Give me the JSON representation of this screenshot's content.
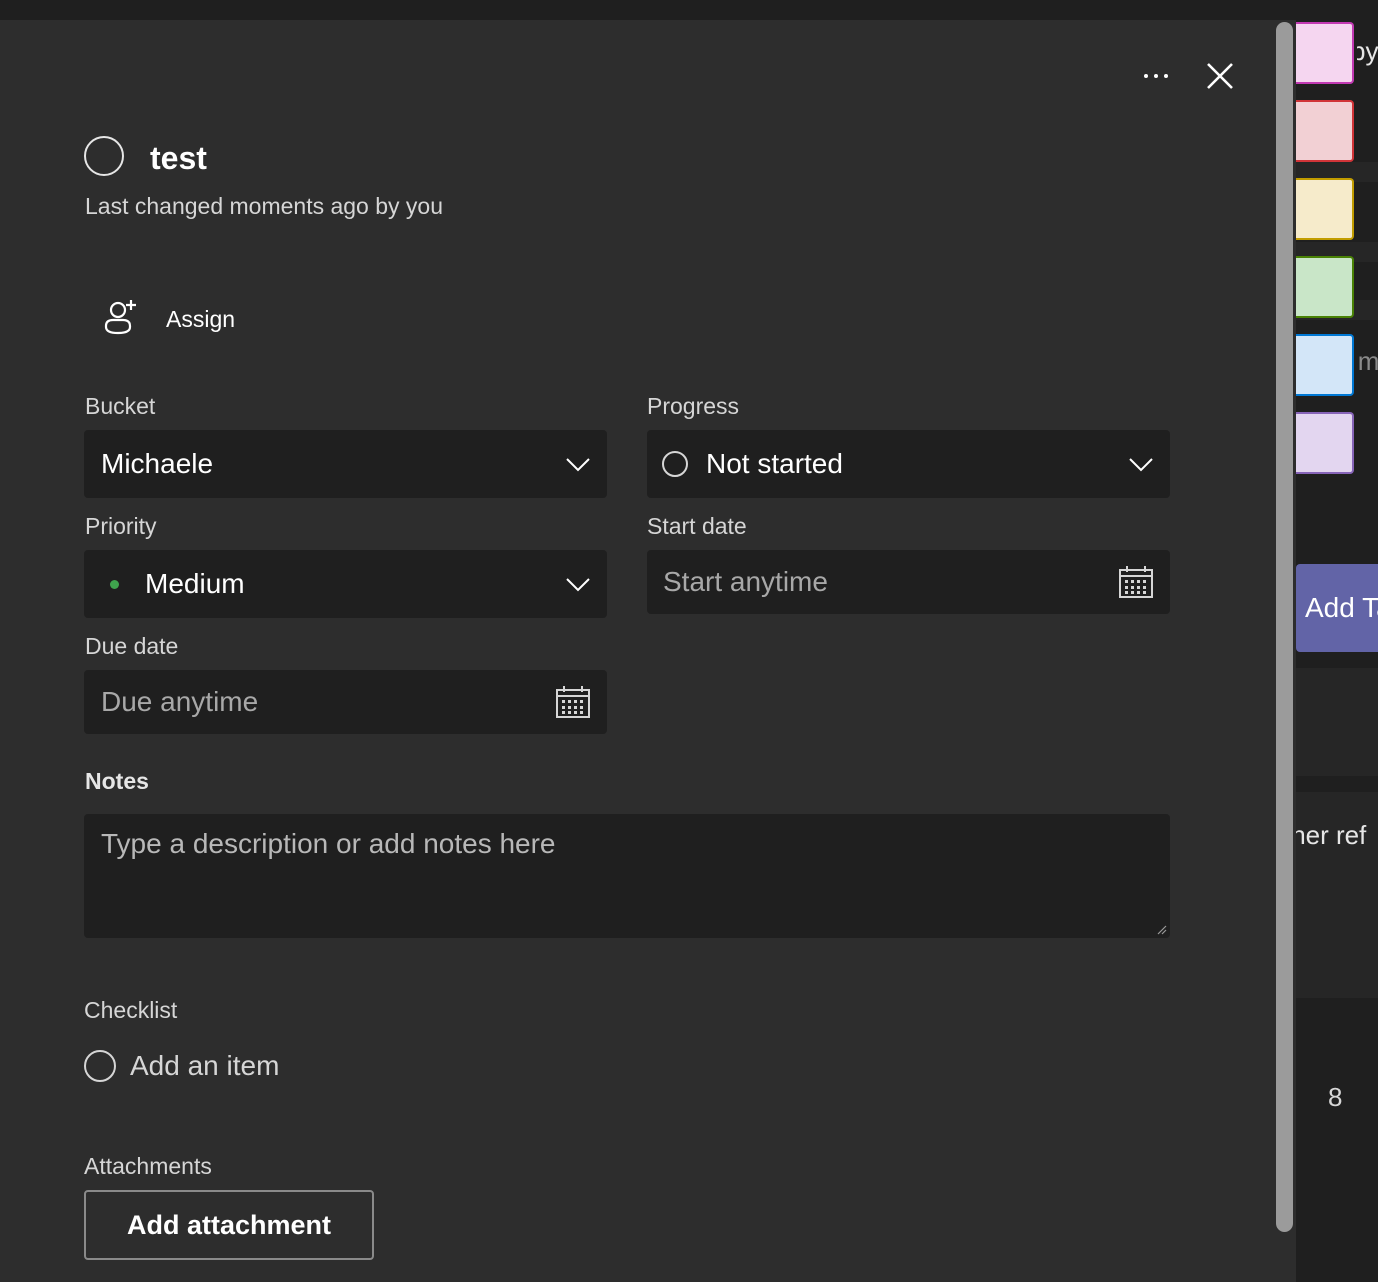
{
  "task": {
    "title": "test",
    "last_changed": "Last changed moments ago by you"
  },
  "header": {
    "more_icon": "more-horizontal-icon",
    "close_icon": "close-icon"
  },
  "assign": {
    "label": "Assign",
    "icon": "add-person-icon"
  },
  "fields": {
    "bucket": {
      "label": "Bucket",
      "value": "Michaele"
    },
    "progress": {
      "label": "Progress",
      "value": "Not started"
    },
    "priority": {
      "label": "Priority",
      "value": "Medium",
      "dot_color": "#3fa34d"
    },
    "start_date": {
      "label": "Start date",
      "placeholder": "Start anytime"
    },
    "due_date": {
      "label": "Due date",
      "placeholder": "Due anytime"
    }
  },
  "notes": {
    "label": "Notes",
    "placeholder": "Type a description or add notes here"
  },
  "checklist": {
    "label": "Checklist",
    "add_item": "Add an item"
  },
  "attachments": {
    "label": "Attachments",
    "button": "Add attachment"
  },
  "background": {
    "fragments": [
      "by",
      "im",
      "Add Ta",
      "tner ref",
      "8"
    ],
    "label_swatches": [
      "#f5d6f0",
      "#f2d0d4",
      "#f6ebcb",
      "#c9e6c8",
      "#d3e6f8",
      "#e3d6f0"
    ],
    "label_borders": [
      "#c239b3",
      "#d13438",
      "#c19c00",
      "#498205",
      "#0078d4",
      "#8764b8"
    ],
    "accent": "#6264a7"
  }
}
